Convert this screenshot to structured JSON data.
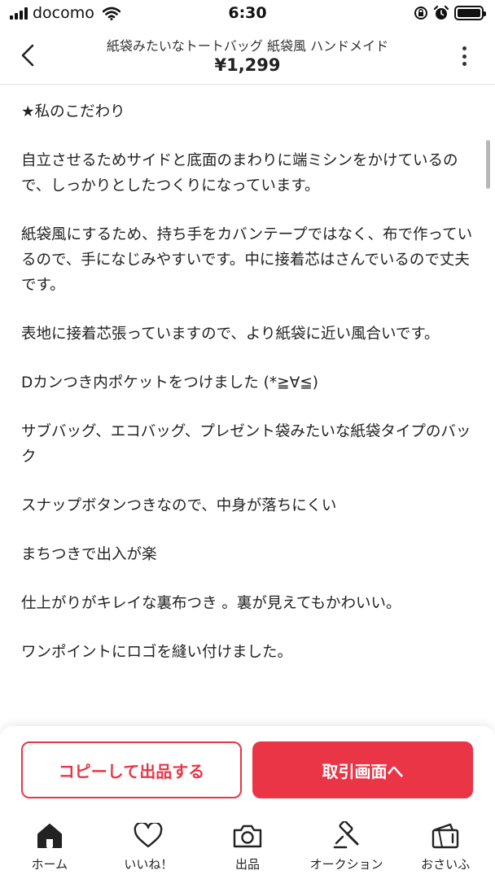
{
  "status_bar": {
    "carrier": "docomo",
    "time": "6:30"
  },
  "header": {
    "title": "紙袋みたいなトートバッグ 紙袋風 ハンドメイド",
    "price": "¥1,299"
  },
  "description": [
    "★私のこだわり",
    "自立させるためサイドと底面のまわりに端ミシンをかけているので、しっかりとしたつくりになっています。",
    "紙袋風にするため、持ち手をカバンテープではなく、布で作っているので、手になじみやすいです。中に接着芯はさんでいるので丈夫です。",
    "表地に接着芯張っていますので、より紙袋に近い風合いです。",
    "Dカンつき内ポケットをつけました (*≧∀≦)",
    "サブバッグ、エコバッグ、プレゼント袋みたいな紙袋タイプのバック",
    "スナップボタンつきなので、中身が落ちにくい",
    "まちつきで出入が楽",
    "仕上がりがキレイな裏布つき 。裏が見えてもかわいい。",
    "ワンポイントにロゴを縫い付けました。"
  ],
  "actions": {
    "copy_label": "コピーして出品する",
    "trade_label": "取引画面へ"
  },
  "tabs": [
    {
      "label": "ホーム",
      "icon": "home-icon"
    },
    {
      "label": "いいね！",
      "icon": "heart-icon"
    },
    {
      "label": "出品",
      "icon": "camera-icon"
    },
    {
      "label": "オークション",
      "icon": "gavel-icon"
    },
    {
      "label": "おさいふ",
      "icon": "wallet-icon"
    }
  ],
  "colors": {
    "accent": "#ea3546"
  }
}
